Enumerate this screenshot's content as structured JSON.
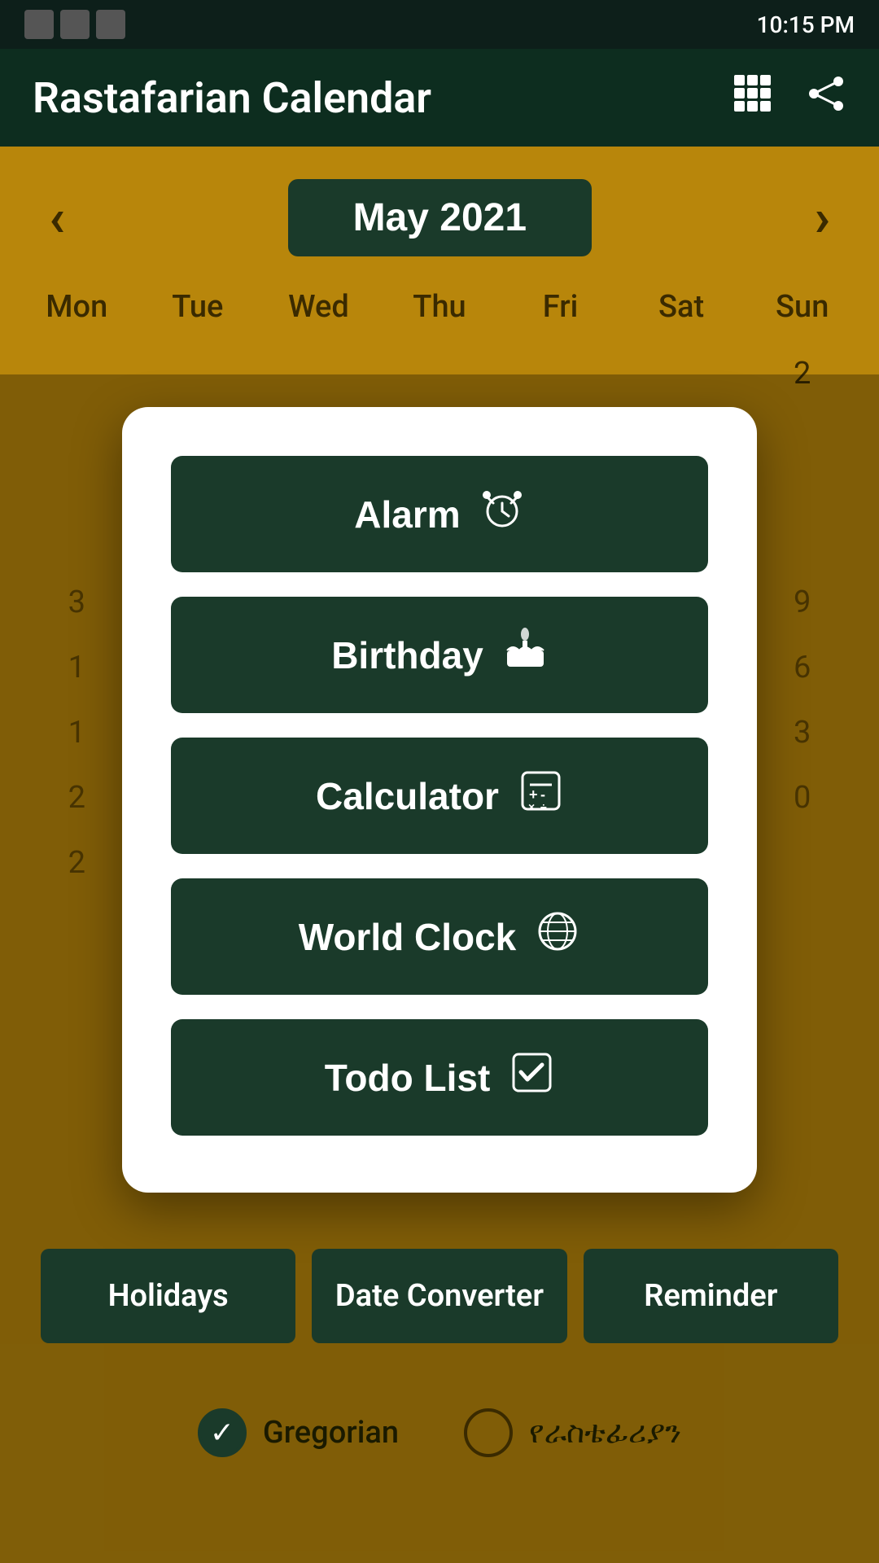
{
  "statusBar": {
    "time": "10:15 PM"
  },
  "appBar": {
    "title": "Rastafarian Calendar",
    "gridIcon": "⊞",
    "shareIcon": "⇧"
  },
  "calendar": {
    "monthLabel": "May 2021",
    "dayHeaders": [
      "Mon",
      "Tue",
      "Wed",
      "Thu",
      "Fri",
      "Sat",
      "Sun"
    ],
    "visibleNumbers": {
      "row1": [
        "",
        "",
        "",
        "",
        "",
        "",
        "2"
      ],
      "row2": [
        "3",
        "",
        "",
        "",
        "",
        "",
        "9"
      ],
      "row3": [
        "1",
        "",
        "",
        "",
        "",
        "",
        "6"
      ],
      "row4": [
        "1",
        "",
        "",
        "",
        "",
        "",
        "3"
      ],
      "row5": [
        "2",
        "",
        "",
        "",
        "",
        "",
        "0"
      ],
      "row6": [
        "2",
        "",
        "",
        "",
        "",
        "",
        ""
      ]
    }
  },
  "modal": {
    "buttons": [
      {
        "label": "Alarm",
        "icon": "⏰"
      },
      {
        "label": "Birthday",
        "icon": "🎂"
      },
      {
        "label": "Calculator",
        "icon": "🖩"
      },
      {
        "label": "World Clock",
        "icon": "🌐"
      },
      {
        "label": "Todo List",
        "icon": "☑"
      }
    ]
  },
  "bottomTabs": [
    {
      "label": "Holidays"
    },
    {
      "label": "Date Converter"
    },
    {
      "label": "Reminder"
    }
  ],
  "calendarTypes": [
    {
      "label": "Gregorian",
      "selected": true
    },
    {
      "label": "የራስቴፊሪያን",
      "selected": false
    }
  ]
}
